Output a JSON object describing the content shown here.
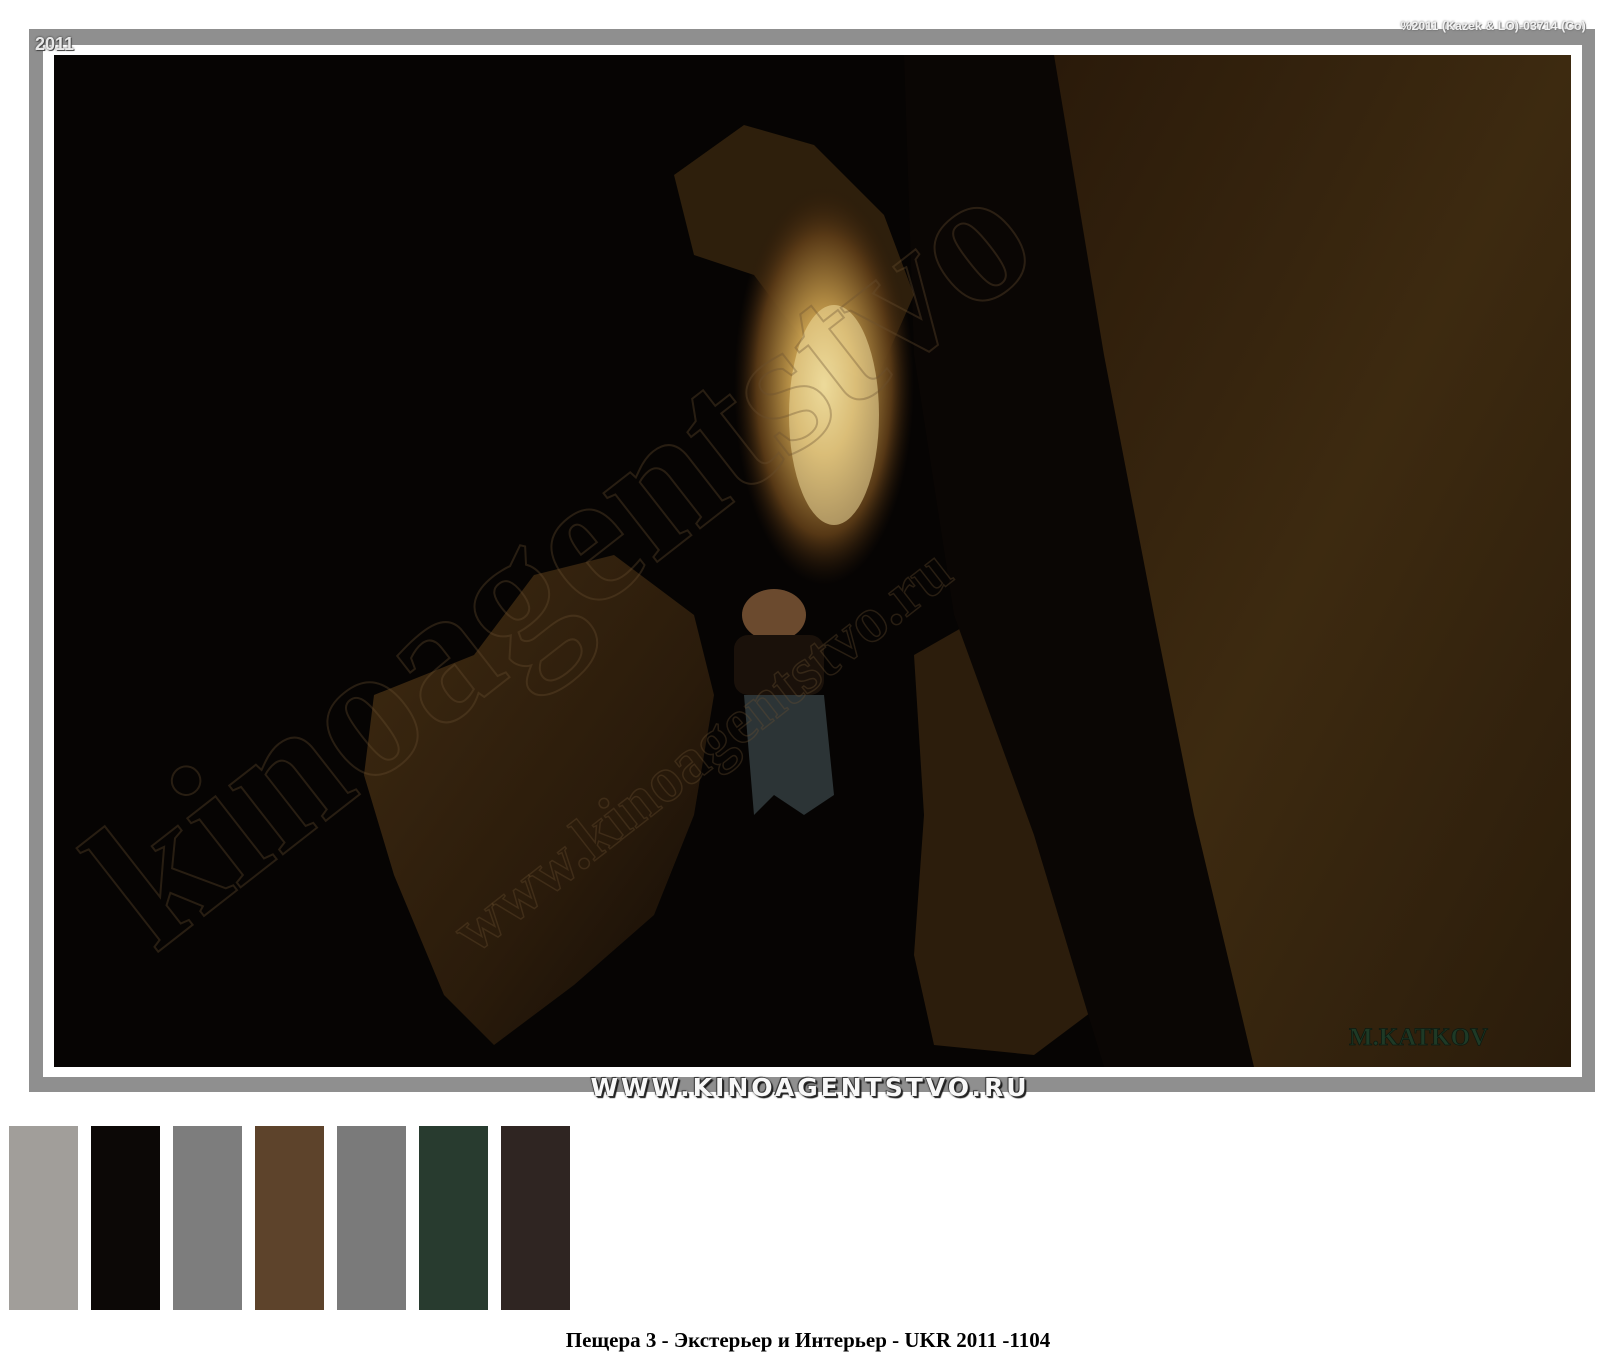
{
  "photo": {
    "year_stamp": "2011",
    "code_stamp": "%2011 (Kazek & LO)-03714 (Co)",
    "signature": "M.KATKOV",
    "watermark_large": "kinoagentstvo",
    "watermark_small": "www.kinoagentstvo.ru"
  },
  "site_banner": "WWW.KINOAGENTSTVO.RU",
  "palette": {
    "colors": [
      "#a19e9a",
      "#0c0806",
      "#7d7d7d",
      "#5d432b",
      "#7a7a7a",
      "#283b2f",
      "#2f2522"
    ]
  },
  "caption": "Пещера 3 - Экстерьер и Интерьер - UKR 2011 -1104"
}
